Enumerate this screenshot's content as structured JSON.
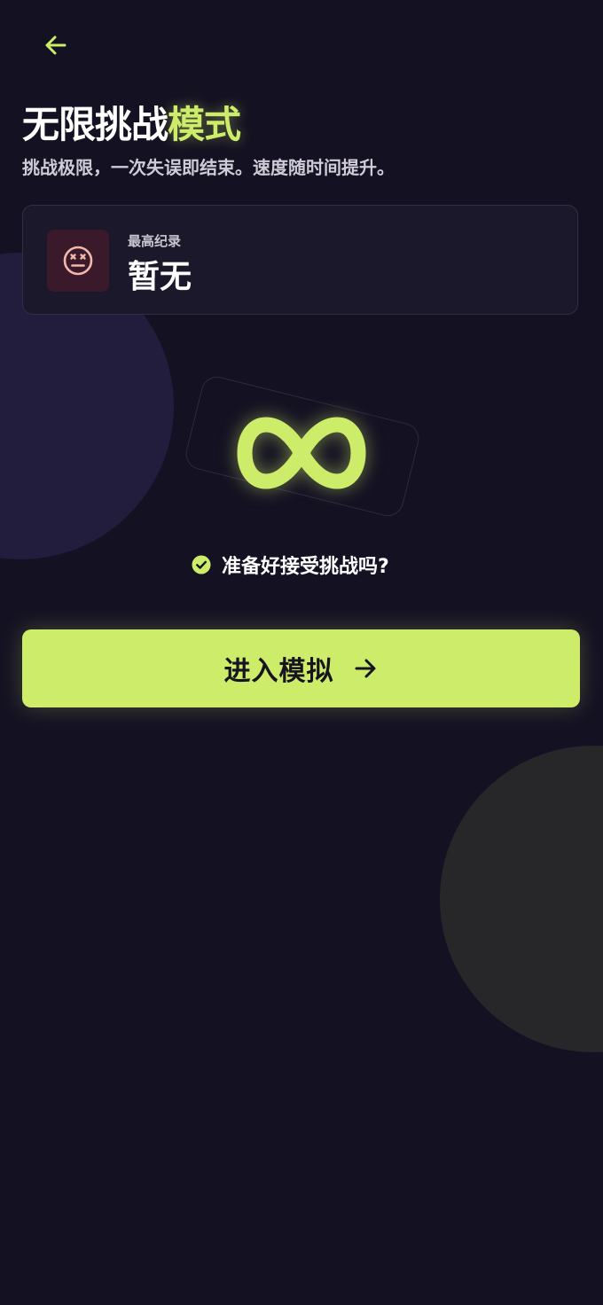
{
  "header": {
    "back_icon": "arrow-left-icon"
  },
  "title": {
    "main": "无限挑战",
    "accent": "模式"
  },
  "subtitle": "挑战极限，一次失误即结束。速度随时间提升。",
  "record": {
    "icon": "dizzy-face-icon",
    "label": "最高纪录",
    "value": "暂无"
  },
  "hero": {
    "icon": "infinity-icon"
  },
  "ready": {
    "icon": "check-circle-icon",
    "text": "准备好接受挑战吗?"
  },
  "enter_button": {
    "label": "进入模拟",
    "icon": "arrow-right-icon"
  },
  "colors": {
    "background": "#141122",
    "accent": "#cdec6a",
    "card": "#1b182c",
    "record_icon_bg": "#3a1a2a",
    "record_icon": "#f2b7ad"
  }
}
